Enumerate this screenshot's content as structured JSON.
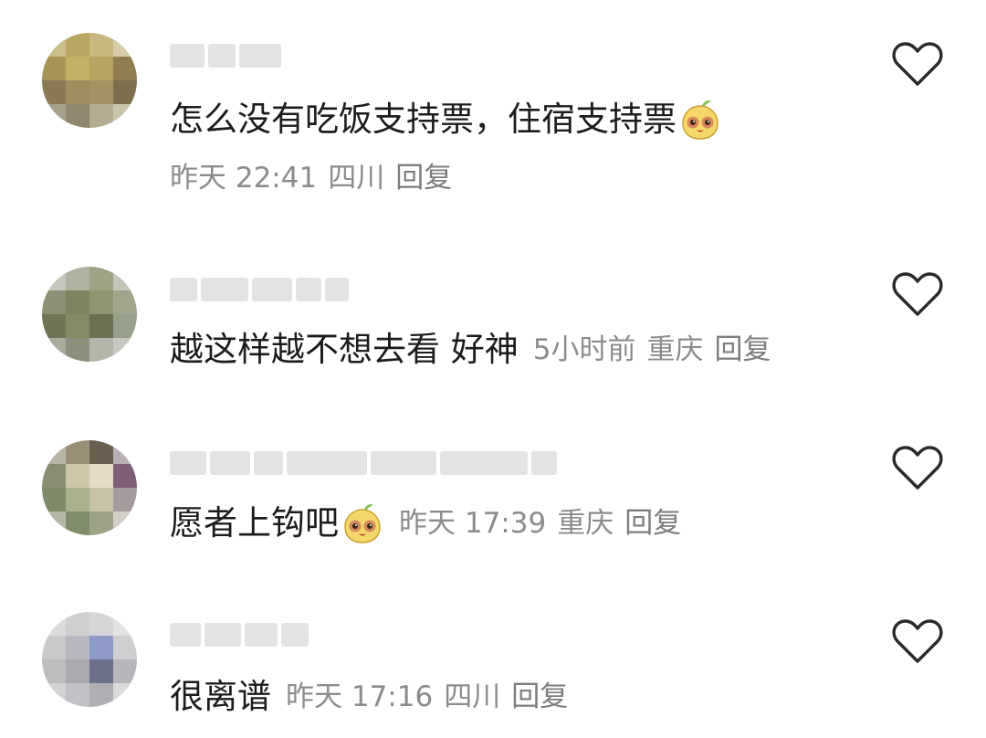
{
  "comments": [
    {
      "text": "怎么没有吃饭支持票，住宿支持票",
      "time": "昨天 22:41",
      "location": "四川",
      "reply": "回复"
    },
    {
      "text": "越这样越不想去看 好神",
      "time": "5小时前",
      "location": "重庆",
      "reply": "回复"
    },
    {
      "text": "愿者上钩吧",
      "time": "昨天 17:39",
      "location": "重庆",
      "reply": "回复"
    },
    {
      "text": "很离谱",
      "time": "昨天 17:16",
      "location": "四川",
      "reply": "回复"
    }
  ],
  "icons": {
    "like": "heart-outline-icon",
    "emoji": "smiling-face-sticker-icon"
  },
  "colors": {
    "text": "#1c1c1c",
    "meta": "#8c8c8c",
    "placeholder": "#e3e3e3"
  }
}
